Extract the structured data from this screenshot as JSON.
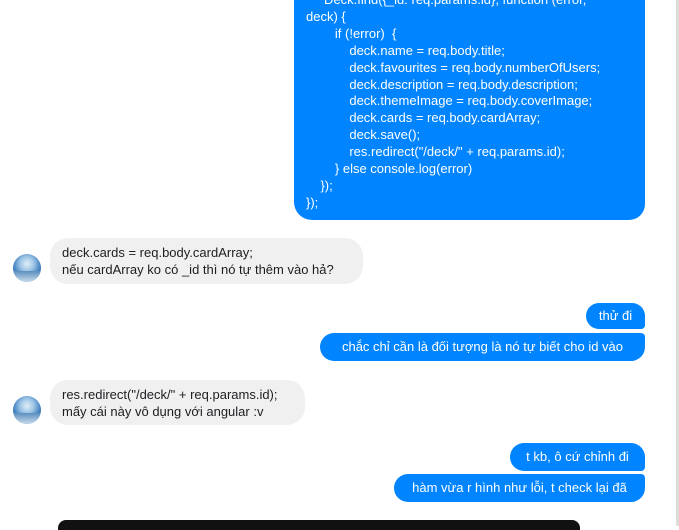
{
  "code_message": {
    "lines": [
      "     Deck.find({_id: req.params.id}, function (error,",
      "deck) {",
      "        if (!error)  {",
      "            deck.name = req.body.title;",
      "            deck.favourites = req.body.numberOfUsers;",
      "            deck.description = req.body.description;",
      "            deck.themeImage = req.body.coverImage;",
      "            deck.cards = req.body.cardArray;",
      "            deck.save();",
      "            res.redirect(\"/deck/\" + req.params.id);",
      "        } else console.log(error)",
      "    });",
      "});"
    ]
  },
  "incoming_1": {
    "line1": "deck.cards = req.body.cardArray;",
    "line2": "nếu cardArray ko có _id thì nó tự thêm vào hả?"
  },
  "outgoing_1": {
    "text": "thử đi"
  },
  "outgoing_2": {
    "text": "chắc chỉ cần là đối tượng là nó tự biết cho id vào"
  },
  "incoming_2": {
    "line1": "res.redirect(\"/deck/\" + req.params.id);",
    "line2": "mấy cái này vô dụng với angular :v"
  },
  "outgoing_3": {
    "text": "t kb, ô cứ chỉnh đi"
  },
  "outgoing_4": {
    "text": "hàm vừa r hình như lỗi, t check lại đã"
  },
  "colors": {
    "sent": "#0084ff",
    "received": "#f1f0f0"
  }
}
